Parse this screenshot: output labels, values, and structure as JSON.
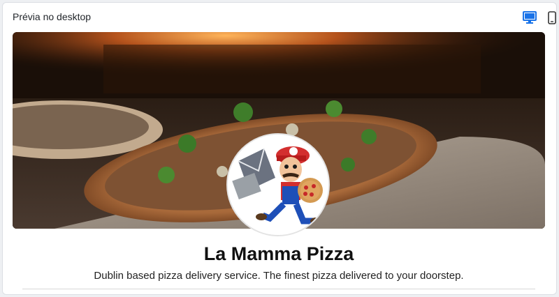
{
  "header": {
    "title": "Prévia no desktop",
    "active_color": "#1a73e8",
    "icons": {
      "desktop": "desktop-monitor-icon",
      "mobile": "mobile-phone-icon"
    }
  },
  "preview": {
    "cover_image": "pizza-oven-photo",
    "avatar_image": "mario-pizza-delivery-mascot",
    "profile_name": "La Mamma Pizza",
    "profile_description": "Dublin based pizza delivery service. The finest pizza delivered to your doorstep."
  }
}
